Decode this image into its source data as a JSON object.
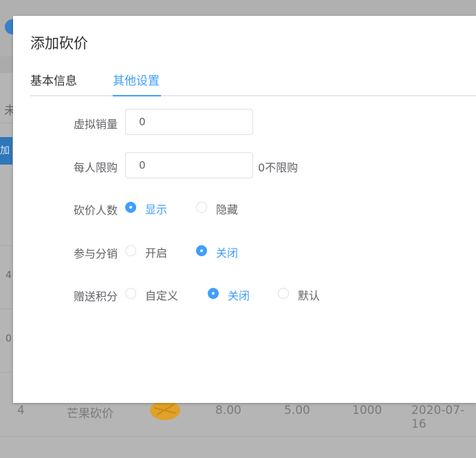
{
  "background": {
    "partial_texts": [
      "未",
      "加",
      "4",
      "0"
    ],
    "row": {
      "index": "4",
      "name": "芒果砍价",
      "price1": "8.00",
      "price2": "5.00",
      "stock": "1000",
      "date": "2020-07-16"
    }
  },
  "dialog": {
    "title": "添加砍价",
    "tabs": [
      {
        "label": "基本信息",
        "active": false
      },
      {
        "label": "其他设置",
        "active": true
      }
    ],
    "fields": {
      "virtual_sales": {
        "label": "虚拟销量",
        "value": "0"
      },
      "limit_per_person": {
        "label": "每人限购",
        "value": "0",
        "hint": "0不限购"
      },
      "bargain_count": {
        "label": "砍价人数",
        "options": [
          {
            "label": "显示",
            "checked": true
          },
          {
            "label": "隐藏",
            "checked": false
          }
        ]
      },
      "distribution": {
        "label": "参与分销",
        "options": [
          {
            "label": "开启",
            "checked": false
          },
          {
            "label": "关闭",
            "checked": true
          }
        ]
      },
      "gift_points": {
        "label": "赠送积分",
        "options": [
          {
            "label": "自定义",
            "checked": false
          },
          {
            "label": "关闭",
            "checked": true
          },
          {
            "label": "默认",
            "checked": false
          }
        ]
      }
    }
  },
  "colors": {
    "primary": "#409eff",
    "text": "#606266",
    "border": "#dcdfe6"
  }
}
